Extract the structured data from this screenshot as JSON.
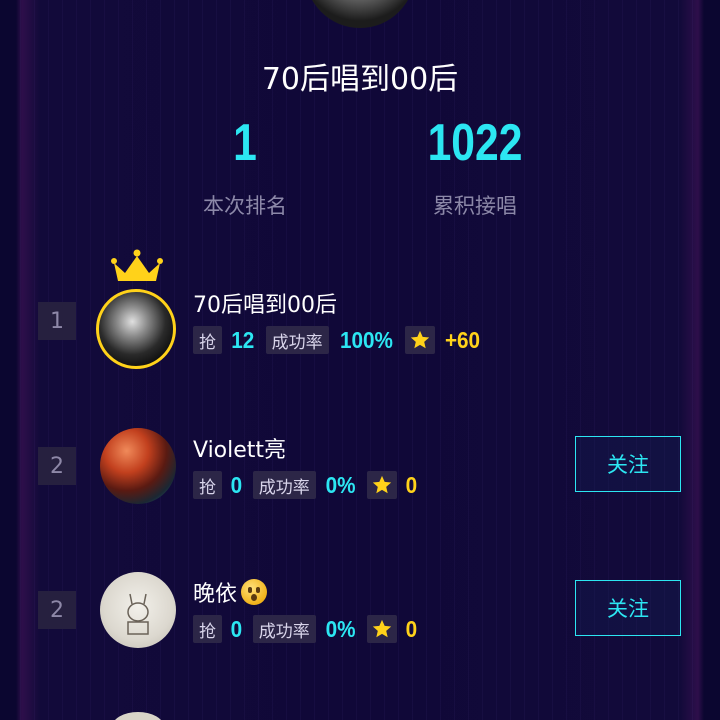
{
  "header": {
    "title": "70后唱到00后"
  },
  "stats": [
    {
      "value": "1",
      "label": "本次排名"
    },
    {
      "value": "1022",
      "label": "累积接唱"
    }
  ],
  "ranking": [
    {
      "rank": "1",
      "name": "70后唱到00后",
      "grab_label": "抢",
      "grab_value": "12",
      "success_label": "成功率",
      "success_value": "100%",
      "star_value": "+60",
      "crown": true
    },
    {
      "rank": "2",
      "name": "Violett亮",
      "grab_label": "抢",
      "grab_value": "0",
      "success_label": "成功率",
      "success_value": "0%",
      "star_value": "0",
      "follow_label": "关注"
    },
    {
      "rank": "2",
      "name": "晚依",
      "grab_label": "抢",
      "grab_value": "0",
      "success_label": "成功率",
      "success_value": "0%",
      "star_value": "0",
      "follow_label": "关注",
      "emoji": "surprised-face"
    }
  ],
  "colors": {
    "accent": "#2ce6f2",
    "gold": "#ffd21a",
    "background": "#100838"
  }
}
